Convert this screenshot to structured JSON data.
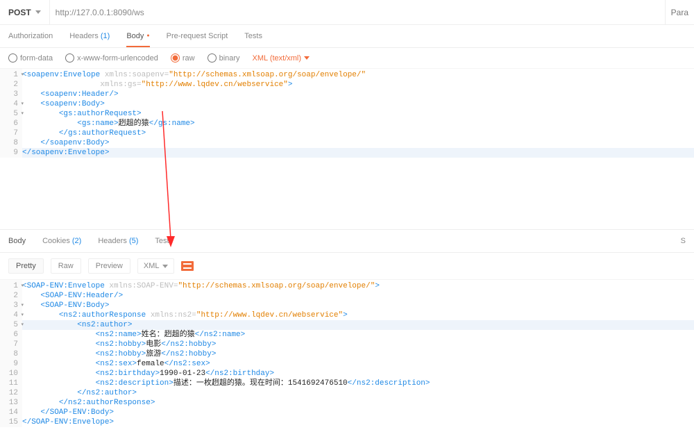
{
  "header": {
    "method": "POST",
    "url": "http://127.0.0.1:8090/ws",
    "params_label": "Para"
  },
  "req_tabs": [
    {
      "key": "auth",
      "label": "Authorization"
    },
    {
      "key": "headers",
      "label": "Headers",
      "count": "(1)"
    },
    {
      "key": "body",
      "label": "Body",
      "active": true,
      "dot": true
    },
    {
      "key": "prereq",
      "label": "Pre-request Script"
    },
    {
      "key": "tests",
      "label": "Tests"
    }
  ],
  "body_radio": {
    "options": [
      {
        "key": "form-data",
        "label": "form-data"
      },
      {
        "key": "urlencoded",
        "label": "x-www-form-urlencoded"
      },
      {
        "key": "raw",
        "label": "raw",
        "checked": true
      },
      {
        "key": "binary",
        "label": "binary"
      }
    ],
    "format_label": "XML (text/xml)"
  },
  "request_code": {
    "highlight_line": 9,
    "fold_lines": [
      1,
      4,
      5
    ],
    "lines": [
      {
        "segs": [
          {
            "t": "<soapenv:Envelope",
            "c": "tg"
          },
          {
            "t": " xmlns:soapenv=",
            "c": "at"
          },
          {
            "t": "\"http://schemas.xmlsoap.org/soap/envelope/\"",
            "c": "vl"
          }
        ]
      },
      {
        "indent": 17,
        "segs": [
          {
            "t": "xmlns:gs=",
            "c": "at"
          },
          {
            "t": "\"http://www.lqdev.cn/webservice\"",
            "c": "vl"
          },
          {
            "t": ">",
            "c": "tg"
          }
        ]
      },
      {
        "indent": 4,
        "segs": [
          {
            "t": "<soapenv:Header/>",
            "c": "tg"
          }
        ]
      },
      {
        "indent": 4,
        "segs": [
          {
            "t": "<soapenv:Body>",
            "c": "tg"
          }
        ]
      },
      {
        "indent": 8,
        "segs": [
          {
            "t": "<gs:authorRequest>",
            "c": "tg"
          }
        ]
      },
      {
        "indent": 12,
        "segs": [
          {
            "t": "<gs:name>",
            "c": "tg"
          },
          {
            "t": "趔趄的猿",
            "c": "tx"
          },
          {
            "t": "</gs:name>",
            "c": "tg"
          }
        ]
      },
      {
        "indent": 8,
        "segs": [
          {
            "t": "</gs:authorRequest>",
            "c": "tg"
          }
        ]
      },
      {
        "indent": 4,
        "segs": [
          {
            "t": "</soapenv:Body>",
            "c": "tg"
          }
        ]
      },
      {
        "segs": [
          {
            "t": "</soapenv:Envelope>",
            "c": "tg"
          }
        ]
      }
    ]
  },
  "resp_tabs": [
    {
      "key": "body",
      "label": "Body",
      "active": true
    },
    {
      "key": "cookies",
      "label": "Cookies",
      "count": "(2)"
    },
    {
      "key": "headers",
      "label": "Headers",
      "count": "(5)"
    },
    {
      "key": "tests",
      "label": "Tests"
    }
  ],
  "resp_right": {
    "status_label": "S"
  },
  "view_row": {
    "buttons": [
      {
        "key": "pretty",
        "label": "Pretty",
        "active": true
      },
      {
        "key": "raw",
        "label": "Raw"
      },
      {
        "key": "preview",
        "label": "Preview"
      }
    ],
    "format_label": "XML"
  },
  "response_code": {
    "highlight_line": 5,
    "fold_lines": [
      1,
      3,
      4,
      5
    ],
    "lines": [
      {
        "segs": [
          {
            "t": "<SOAP-ENV:Envelope",
            "c": "tg"
          },
          {
            "t": " xmlns:SOAP-ENV=",
            "c": "at"
          },
          {
            "t": "\"http://schemas.xmlsoap.org/soap/envelope/\"",
            "c": "vl"
          },
          {
            "t": ">",
            "c": "tg"
          }
        ]
      },
      {
        "indent": 4,
        "segs": [
          {
            "t": "<SOAP-ENV:Header/>",
            "c": "tg"
          }
        ]
      },
      {
        "indent": 4,
        "segs": [
          {
            "t": "<SOAP-ENV:Body>",
            "c": "tg"
          }
        ]
      },
      {
        "indent": 8,
        "segs": [
          {
            "t": "<ns2:authorResponse",
            "c": "tg"
          },
          {
            "t": " xmlns:ns2=",
            "c": "at"
          },
          {
            "t": "\"http://www.lqdev.cn/webservice\"",
            "c": "vl"
          },
          {
            "t": ">",
            "c": "tg"
          }
        ]
      },
      {
        "indent": 12,
        "segs": [
          {
            "t": "<ns2:author>",
            "c": "tg"
          }
        ]
      },
      {
        "indent": 16,
        "segs": [
          {
            "t": "<ns2:name>",
            "c": "tg"
          },
          {
            "t": "姓名：趔趄的猿",
            "c": "tx"
          },
          {
            "t": "</ns2:name>",
            "c": "tg"
          }
        ]
      },
      {
        "indent": 16,
        "segs": [
          {
            "t": "<ns2:hobby>",
            "c": "tg"
          },
          {
            "t": "电影",
            "c": "tx"
          },
          {
            "t": "</ns2:hobby>",
            "c": "tg"
          }
        ]
      },
      {
        "indent": 16,
        "segs": [
          {
            "t": "<ns2:hobby>",
            "c": "tg"
          },
          {
            "t": "旅游",
            "c": "tx"
          },
          {
            "t": "</ns2:hobby>",
            "c": "tg"
          }
        ]
      },
      {
        "indent": 16,
        "segs": [
          {
            "t": "<ns2:sex>",
            "c": "tg"
          },
          {
            "t": "female",
            "c": "tx"
          },
          {
            "t": "</ns2:sex>",
            "c": "tg"
          }
        ]
      },
      {
        "indent": 16,
        "segs": [
          {
            "t": "<ns2:birthday>",
            "c": "tg"
          },
          {
            "t": "1990-01-23",
            "c": "tx"
          },
          {
            "t": "</ns2:birthday>",
            "c": "tg"
          }
        ]
      },
      {
        "indent": 16,
        "segs": [
          {
            "t": "<ns2:description>",
            "c": "tg"
          },
          {
            "t": "描述：一枚趔趄的猿。现在时间：1541692476510",
            "c": "tx"
          },
          {
            "t": "</ns2:description>",
            "c": "tg"
          }
        ]
      },
      {
        "indent": 12,
        "segs": [
          {
            "t": "</ns2:author>",
            "c": "tg"
          }
        ]
      },
      {
        "indent": 8,
        "segs": [
          {
            "t": "</ns2:authorResponse>",
            "c": "tg"
          }
        ]
      },
      {
        "indent": 4,
        "segs": [
          {
            "t": "</SOAP-ENV:Body>",
            "c": "tg"
          }
        ]
      },
      {
        "segs": [
          {
            "t": "</SOAP-ENV:Envelope>",
            "c": "tg"
          }
        ]
      }
    ]
  }
}
